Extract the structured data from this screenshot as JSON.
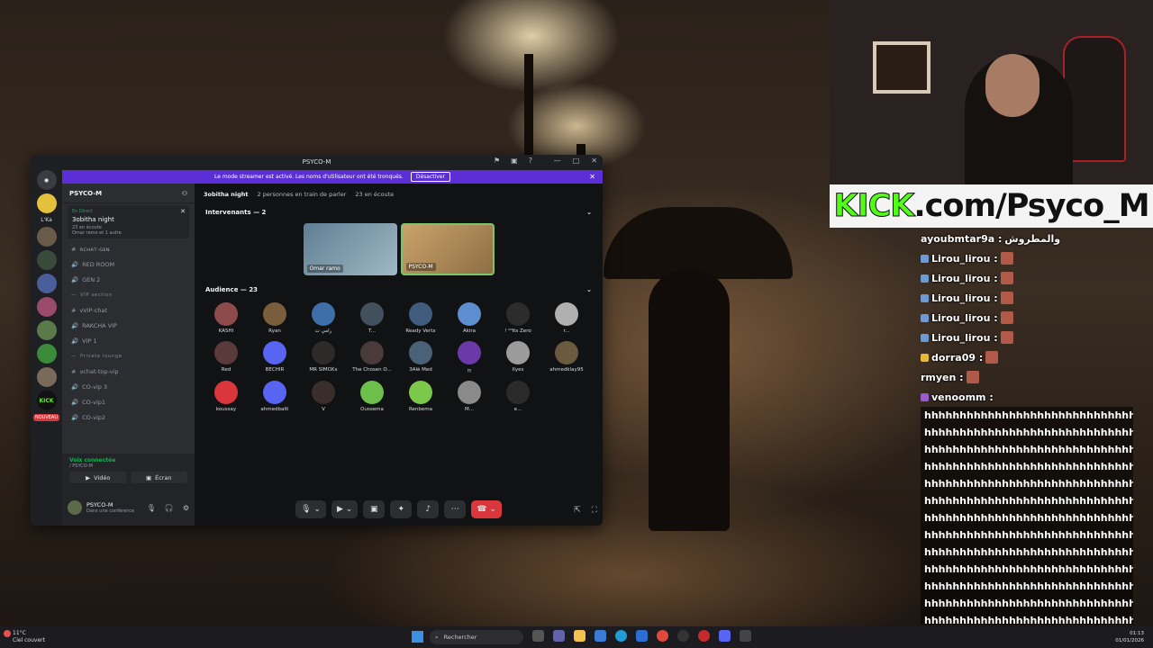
{
  "discord": {
    "window_title": "PSYCO-M",
    "banner": {
      "text": "Le mode streamer est activé. Les noms d'utilisateur ont été tronqués.",
      "button": "Désactiver"
    },
    "guild_labels": [
      "L'Ka",
      "KICK",
      "NOUVEAU"
    ],
    "server_name": "PSYCO-M",
    "live_event": {
      "tag": "En Direct",
      "name": "3obitha night",
      "listeners": "23 en écoute",
      "sub": "Omar ramo et 1 autre"
    },
    "channels": [
      {
        "label": "ʀᴄʜᴀᴛ-ɢᴇɴ",
        "kind": "text",
        "badge": ""
      },
      {
        "label": "RED ROOM",
        "kind": "voice",
        "badge": ""
      },
      {
        "label": "GEN 2",
        "kind": "voice",
        "badge": ""
      },
      {
        "label": "VIP section",
        "kind": "category",
        "badge": ""
      },
      {
        "label": "ᴠVIP-chat",
        "kind": "text",
        "badge": ""
      },
      {
        "label": "RAKCHA VIP",
        "kind": "voice",
        "badge": ""
      },
      {
        "label": "VIP 1",
        "kind": "voice",
        "badge": ""
      },
      {
        "label": "Private lounge",
        "kind": "category",
        "badge": ""
      },
      {
        "label": "ᴠchat-top-vip",
        "kind": "text",
        "badge": ""
      },
      {
        "label": "CO-vip 3",
        "kind": "voice",
        "badge": ""
      },
      {
        "label": "CO-vip1",
        "kind": "voice",
        "badge": ""
      },
      {
        "label": "CO-vip2",
        "kind": "voice",
        "badge": ""
      }
    ],
    "voice_panel": {
      "status": "Voix connectée",
      "sub": "/ PSYCO-M",
      "video": "Vidéo",
      "screen": "Écran"
    },
    "user_panel": {
      "name": "PSYCO-M",
      "status": "Dans une conférence"
    },
    "stage": {
      "title": "3obitha night",
      "speaking": "2 personnes en train de parler",
      "listening": "23 en écoute",
      "speakers_header": "Intervenants — 2",
      "audience_header": "Audience — 23",
      "speakers": [
        {
          "name": "Omar ramo",
          "active": false
        },
        {
          "name": "PSYCO-M",
          "active": true
        }
      ],
      "audience": [
        {
          "name": "KASHI",
          "color": "#8e4b4b"
        },
        {
          "name": "Ryan",
          "color": "#7a5d3a"
        },
        {
          "name": "رامي ت",
          "color": "#3f6fa8"
        },
        {
          "name": "T...",
          "color": "#42505e"
        },
        {
          "name": "Ready Vertx",
          "color": "#405b7b"
        },
        {
          "name": "Akira",
          "color": "#5d8ed0"
        },
        {
          "name": "! ⁰⁰Its Zero",
          "color": "#2c2c2c"
        },
        {
          "name": "r...",
          "color": "#b0b0b0"
        },
        {
          "name": "Red",
          "color": "#5a3a3a"
        },
        {
          "name": "BECHIR",
          "color": "#5865f2"
        },
        {
          "name": "MR SIMOXx",
          "color": "#2e2a2a"
        },
        {
          "name": "The Chosen O...",
          "color": "#4a3a3a"
        },
        {
          "name": "3Alé Med",
          "color": "#4a6278"
        },
        {
          "name": "ஜ",
          "color": "#6b3aa8"
        },
        {
          "name": "Ilyes",
          "color": "#9b9b9b"
        },
        {
          "name": "ahmedklay95",
          "color": "#6b5a3f"
        },
        {
          "name": "koussay",
          "color": "#da373c"
        },
        {
          "name": "ahmedbalti",
          "color": "#5865f2"
        },
        {
          "name": "V",
          "color": "#3a2e2a"
        },
        {
          "name": "Oussema",
          "color": "#6bbf4a"
        },
        {
          "name": "Renbema",
          "color": "#7bc84a"
        },
        {
          "name": "M...",
          "color": "#8a8a8a"
        },
        {
          "name": "e...",
          "color": "#2a2a2a"
        }
      ]
    }
  },
  "overlay": {
    "kick_brand": "KICK",
    "kick_rest": ".com/Psyco_M",
    "chat": [
      {
        "user": "ayoubmtar9a :",
        "text": "والمطروش",
        "icon": "",
        "emote": false
      },
      {
        "user": "Lirou_lirou :",
        "text": "",
        "icon": "blue",
        "emote": true
      },
      {
        "user": "Lirou_lirou :",
        "text": "",
        "icon": "blue",
        "emote": true
      },
      {
        "user": "Lirou_lirou :",
        "text": "",
        "icon": "blue",
        "emote": true
      },
      {
        "user": "Lirou_lirou :",
        "text": "",
        "icon": "blue",
        "emote": true
      },
      {
        "user": "Lirou_lirou :",
        "text": "",
        "icon": "blue",
        "emote": true
      },
      {
        "user": "dorra09 :",
        "text": "",
        "icon": "gold",
        "emote": true
      },
      {
        "user": "rmyen :",
        "text": "",
        "icon": "",
        "emote": true
      },
      {
        "user": "venoomm :",
        "text": "",
        "icon": "purple",
        "emote": false
      }
    ],
    "spam_line": "hhhhhhhhhhhhhhhhhhhhhhhhhhhhhhhhhh",
    "spam_count": 13
  },
  "taskbar": {
    "weather_temp": "11°C",
    "weather_desc": "Ciel couvert",
    "search_placeholder": "Rechercher",
    "time": "01:13",
    "date": "01/01/2026"
  },
  "colors": {
    "accent": "#5c2fd6",
    "online": "#23a55a",
    "danger": "#da373c",
    "kick_green": "#53fc18"
  }
}
